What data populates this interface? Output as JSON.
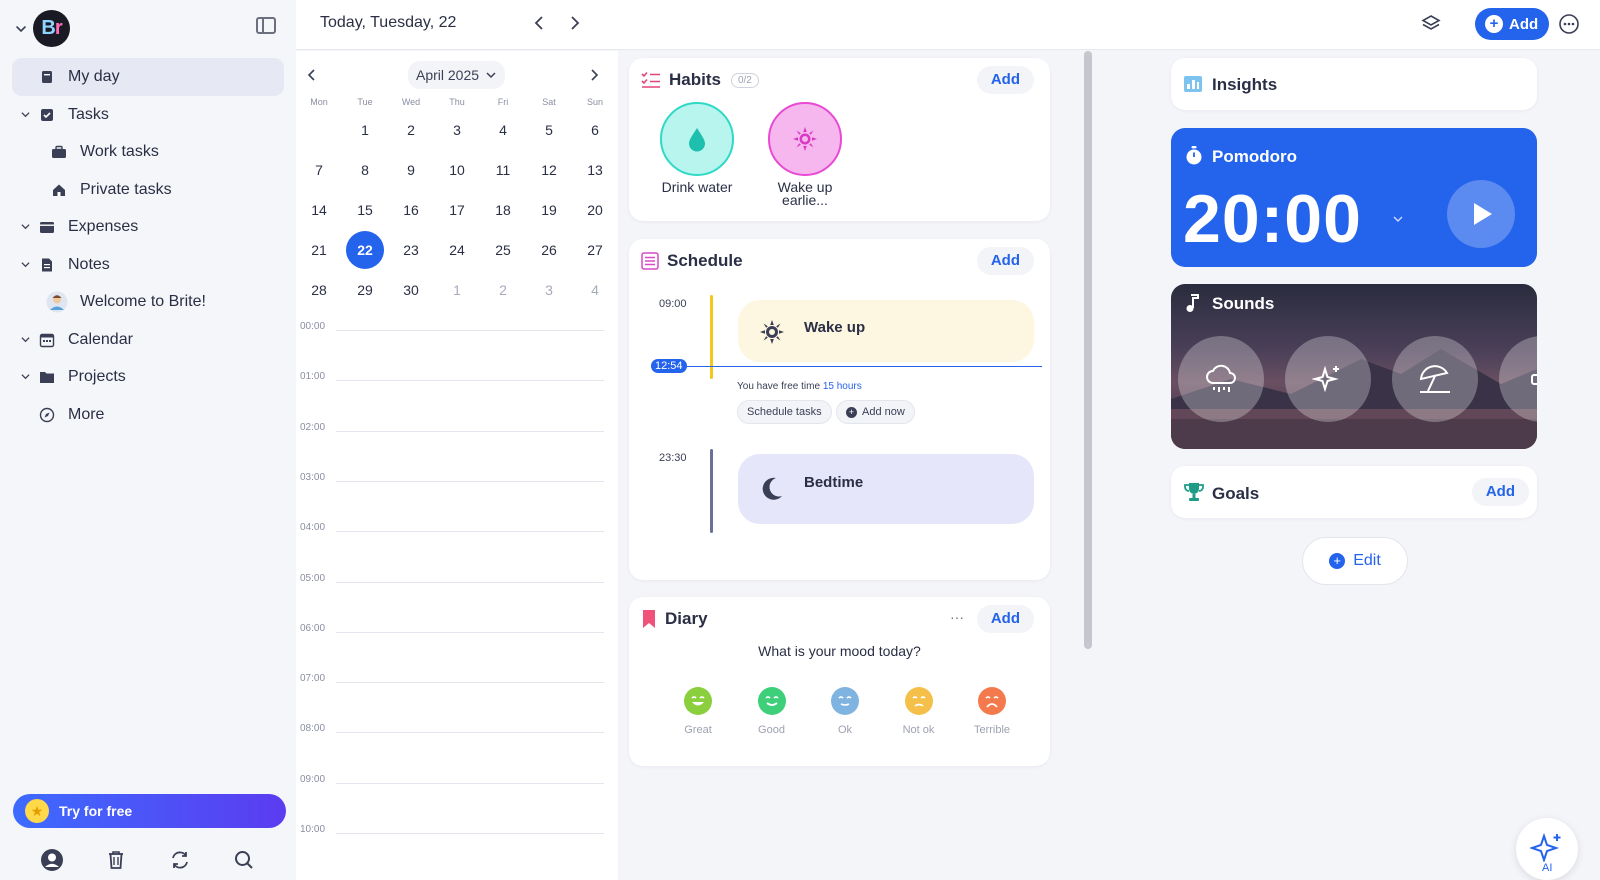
{
  "topbar": {
    "date_title": "Today, Tuesday, 22",
    "add_label": "Add"
  },
  "sidebar": {
    "items": [
      {
        "label": "My day"
      },
      {
        "label": "Tasks"
      },
      {
        "label": "Work tasks"
      },
      {
        "label": "Private tasks"
      },
      {
        "label": "Expenses"
      },
      {
        "label": "Notes"
      },
      {
        "label": "Welcome to Brite!"
      },
      {
        "label": "Calendar"
      },
      {
        "label": "Projects"
      },
      {
        "label": "More"
      }
    ],
    "try_label": "Try for free"
  },
  "calendar": {
    "month_label": "April 2025",
    "weekdays": [
      "Mon",
      "Tue",
      "Wed",
      "Thu",
      "Fri",
      "Sat",
      "Sun"
    ],
    "weeks": [
      [
        "",
        "1",
        "2",
        "3",
        "4",
        "5",
        "6"
      ],
      [
        "7",
        "8",
        "9",
        "10",
        "11",
        "12",
        "13"
      ],
      [
        "14",
        "15",
        "16",
        "17",
        "18",
        "19",
        "20"
      ],
      [
        "21",
        "22",
        "23",
        "24",
        "25",
        "26",
        "27"
      ],
      [
        "28",
        "29",
        "30",
        "1",
        "2",
        "3",
        "4"
      ]
    ],
    "today": "22",
    "hours": [
      "00:00",
      "01:00",
      "02:00",
      "03:00",
      "04:00",
      "05:00",
      "06:00",
      "07:00",
      "08:00",
      "09:00",
      "10:00"
    ]
  },
  "habits": {
    "title": "Habits",
    "count": "0/2",
    "add_label": "Add",
    "items": [
      {
        "name": "Drink water",
        "color": "#2fd9c6"
      },
      {
        "name": "Wake up earlie...",
        "color": "#e84ad4"
      }
    ]
  },
  "schedule": {
    "title": "Schedule",
    "add_label": "Add",
    "wake_time": "09:00",
    "wake_title": "Wake up",
    "now_time": "12:54",
    "free_text": "You have free time",
    "free_amount": "15 hours",
    "schedule_tasks": "Schedule tasks",
    "add_now": "Add now",
    "bed_time": "23:30",
    "bed_title": "Bedtime"
  },
  "diary": {
    "title": "Diary",
    "add_label": "Add",
    "question": "What is your mood today?",
    "moods": [
      {
        "label": "Great",
        "color": "#8bcf3f"
      },
      {
        "label": "Good",
        "color": "#3dcf7a"
      },
      {
        "label": "Ok",
        "color": "#7fb4e0"
      },
      {
        "label": "Not ok",
        "color": "#f5c04a"
      },
      {
        "label": "Terrible",
        "color": "#f47a4e"
      }
    ]
  },
  "right": {
    "insights_title": "Insights",
    "pomodoro_title": "Pomodoro",
    "pomodoro_time": "20:00",
    "sounds_title": "Sounds",
    "goals_title": "Goals",
    "goals_add": "Add",
    "edit_label": "Edit",
    "ai_label": "AI"
  },
  "colors": {
    "accent": "#2463eb"
  }
}
